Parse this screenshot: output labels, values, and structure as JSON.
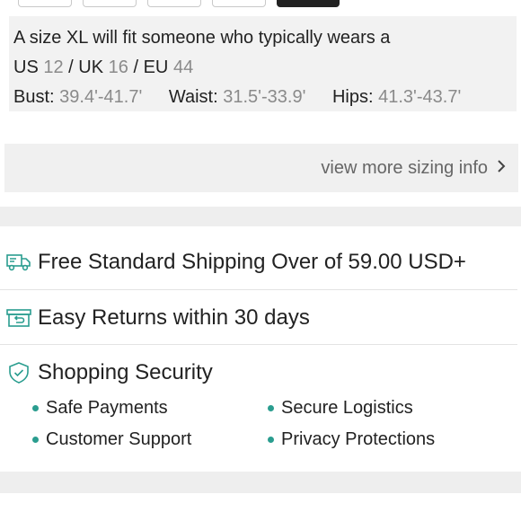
{
  "fit": {
    "intro": "A size XL will fit someone who typically wears a",
    "us_label": "US",
    "us_value": "12",
    "uk_label": "UK",
    "uk_value": "16",
    "eu_label": "EU",
    "eu_value": "44",
    "sep": "/",
    "bust_label": "Bust:",
    "bust_value": "39.4'-41.7'",
    "waist_label": "Waist:",
    "waist_value": "31.5'-33.9'",
    "hips_label": "Hips:",
    "hips_value": "41.3'-43.7'"
  },
  "more_sizing": {
    "label": "view more sizing info"
  },
  "services": [
    {
      "label": "Free Standard Shipping Over of 59.00 USD+",
      "icon": "truck-icon"
    },
    {
      "label": "Easy Returns within 30 days",
      "icon": "return-box-icon"
    },
    {
      "label": "Shopping Security",
      "icon": "shield-check-icon"
    }
  ],
  "security_items": [
    "Safe Payments",
    "Secure Logistics",
    "Customer Support",
    "Privacy Protections"
  ],
  "colors": {
    "accent": "#2a9d8f",
    "panel": "#f2f2f2",
    "text": "#222222",
    "muted": "#8a8a8a"
  }
}
